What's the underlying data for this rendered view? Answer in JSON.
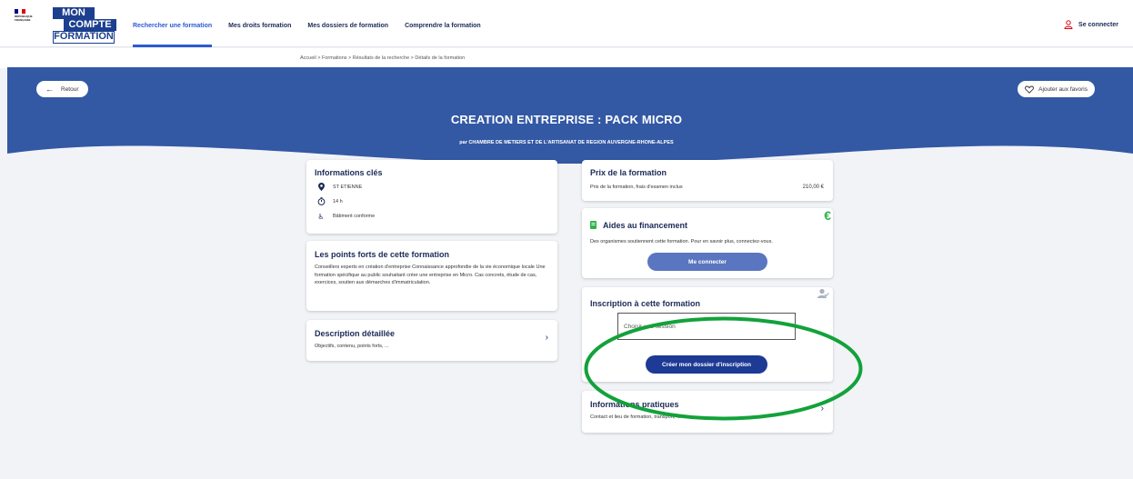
{
  "header": {
    "gov_logo_text": "RÉPUBLIQUE FRANÇAISE",
    "brand": {
      "mon": "MON",
      "compte": "COMPTE",
      "formation": "FORMATION"
    },
    "nav": [
      {
        "label": "Rechercher une formation",
        "active": true
      },
      {
        "label": "Mes droits formation",
        "active": false
      },
      {
        "label": "Mes dossiers de formation",
        "active": false
      },
      {
        "label": "Comprendre la formation",
        "active": false
      }
    ],
    "connect_label": "Se connecter"
  },
  "breadcrumb": "Accueil > Formations > Résultats de la recherche > Détails de la formation",
  "hero": {
    "back_label": "Retour",
    "favorite_label": "Ajouter aux favoris",
    "title": "CREATION ENTREPRISE : PACK MICRO",
    "subtitle": "par CHAMBRE DE METIERS ET DE L'ARTISANAT DE REGION AUVERGNE-RHONE-ALPES"
  },
  "info_cles": {
    "heading": "Informations clés",
    "location": "ST ETIENNE",
    "duration": "14 h",
    "accessibility": "Bâtiment conforme"
  },
  "points_forts": {
    "heading": "Les points forts de cette formation",
    "text": "Conseillers experts en création d'entreprise Connaissance approfondie de la vie économique locale Une formation spécifique au public souhaitant créer une entreprise en Micro. Cas concrets, étude de cas, exercices, soutien aux démarches d'immatriculation."
  },
  "description": {
    "heading": "Description détaillée",
    "text": "Objectifs, contenu, points forts, ..."
  },
  "prix": {
    "heading": "Prix de la formation",
    "label": "Prix de la formation, frais d'examen inclus",
    "amount": "210,00 €"
  },
  "aides": {
    "heading": "Aides au financement",
    "text": "Des organismes soutiennent cette formation. Pour en savoir plus, connectez-vous.",
    "button": "Me connecter",
    "badge": "€"
  },
  "inscription": {
    "heading": "Inscription à cette formation",
    "select_placeholder": "Choisir une session",
    "button": "Créer mon dossier d'inscription"
  },
  "pratiques": {
    "heading": "Informations pratiques",
    "text": "Contact et lieu de formation, transport, ..."
  },
  "colors": {
    "navy": "#1b2a57",
    "hero_blue": "#3358a4",
    "button_dark": "#1d3a94",
    "button_mid": "#5a76c0",
    "annotation_green": "#12a23a",
    "euro_green": "#2fb24a"
  }
}
